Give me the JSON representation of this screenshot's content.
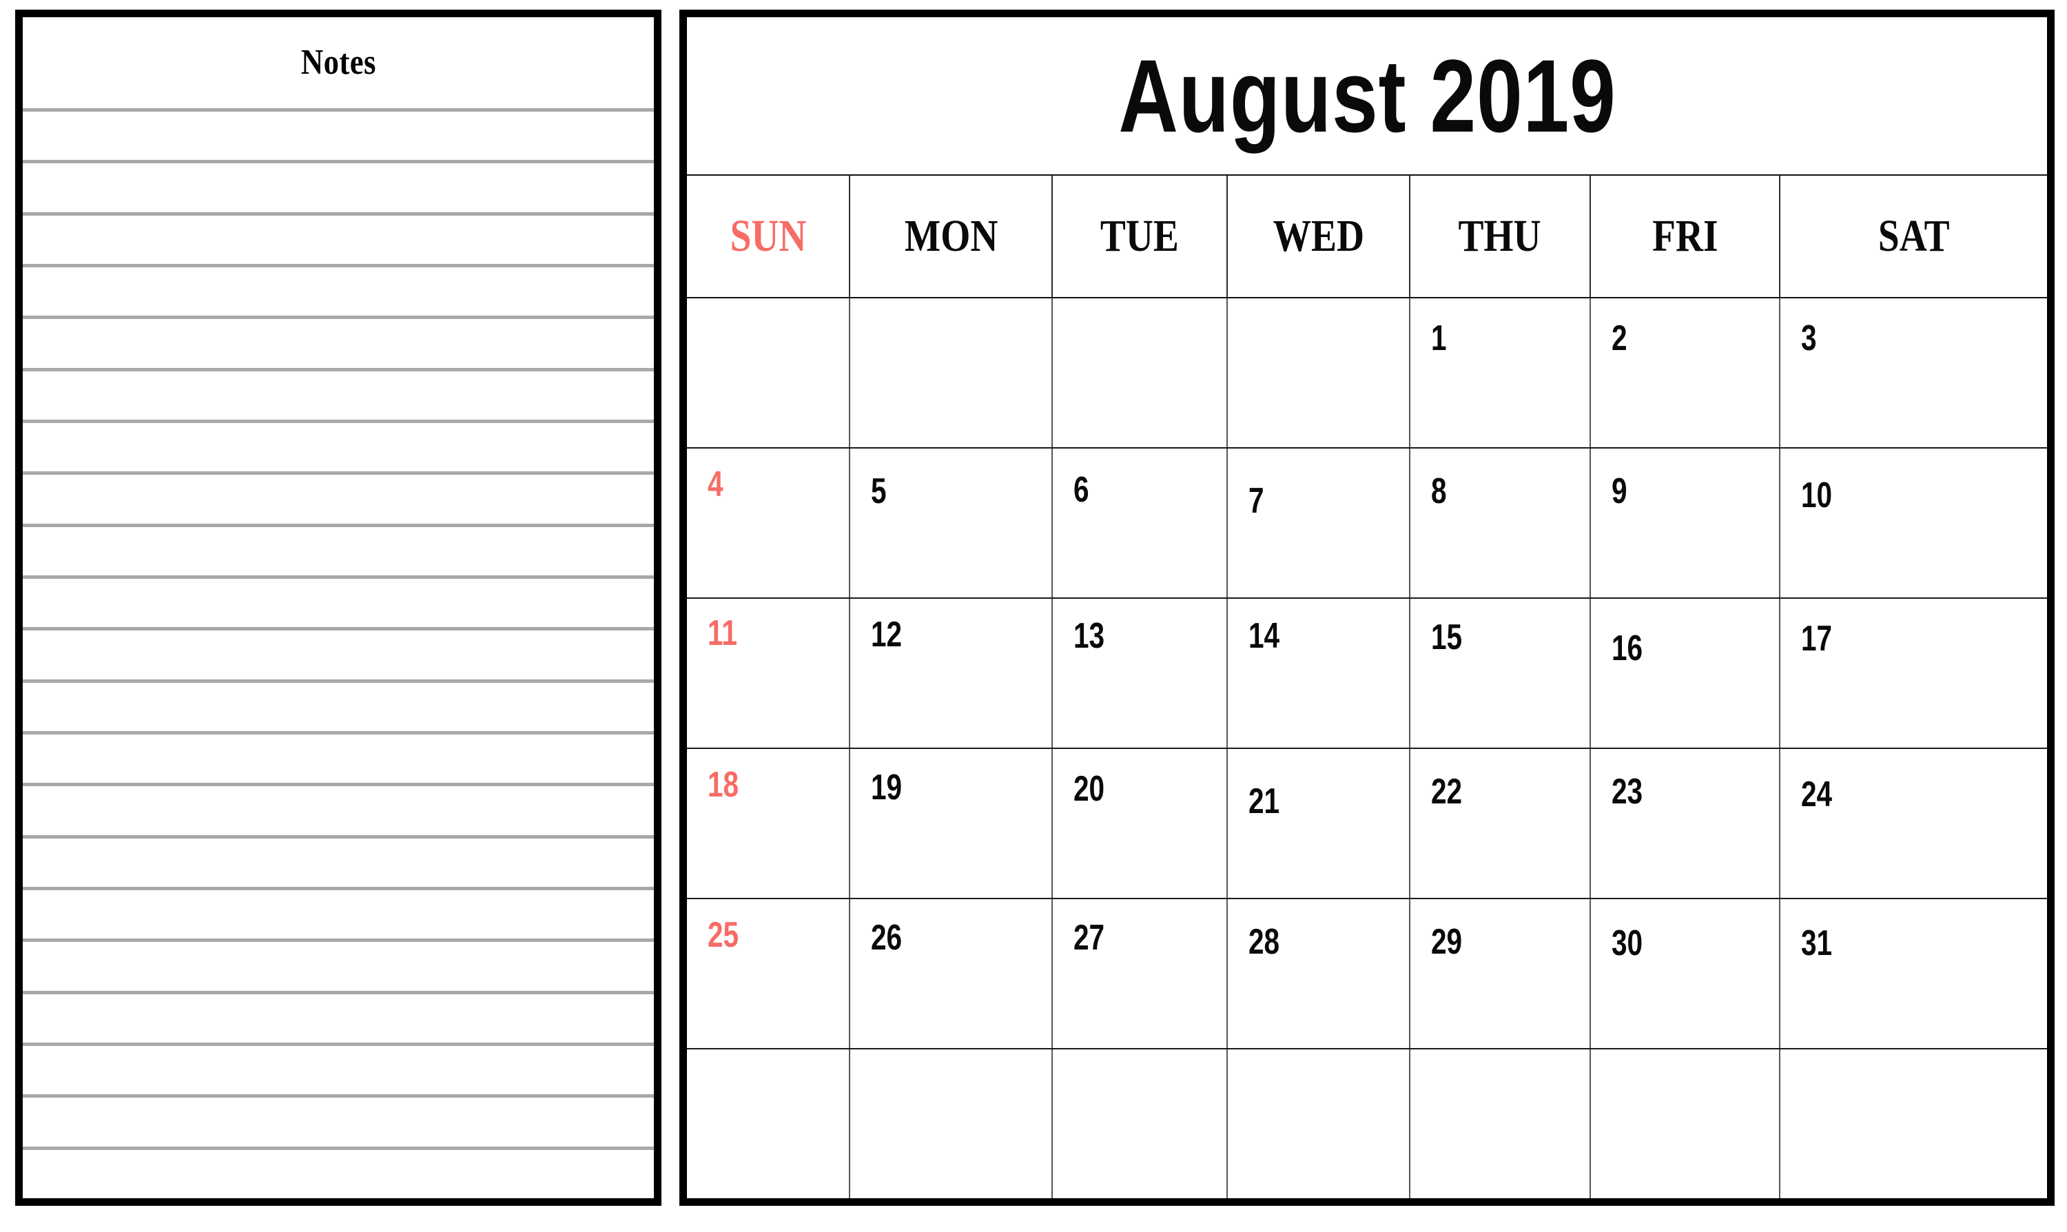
{
  "notes": {
    "title": "Notes",
    "line_count": 21
  },
  "calendar": {
    "title": "August 2019",
    "month": "August",
    "year": "2019",
    "weekday_headers": [
      {
        "label": "SUN",
        "is_sunday": true
      },
      {
        "label": "MON",
        "is_sunday": false
      },
      {
        "label": "TUE",
        "is_sunday": false
      },
      {
        "label": "WED",
        "is_sunday": false
      },
      {
        "label": "THU",
        "is_sunday": false
      },
      {
        "label": "FRI",
        "is_sunday": false
      },
      {
        "label": "SAT",
        "is_sunday": false
      }
    ],
    "weeks": [
      {
        "days": [
          {
            "label": "",
            "offset": 0
          },
          {
            "label": "",
            "offset": 0
          },
          {
            "label": "",
            "offset": 0
          },
          {
            "label": "",
            "offset": 0
          },
          {
            "label": "1",
            "offset": 18
          },
          {
            "label": "2",
            "offset": 18
          },
          {
            "label": "3",
            "offset": 18
          }
        ]
      },
      {
        "days": [
          {
            "label": "4",
            "offset": 12
          },
          {
            "label": "5",
            "offset": 22
          },
          {
            "label": "6",
            "offset": 20
          },
          {
            "label": "7",
            "offset": 36
          },
          {
            "label": "8",
            "offset": 22
          },
          {
            "label": "9",
            "offset": 22
          },
          {
            "label": "10",
            "offset": 28
          }
        ]
      },
      {
        "days": [
          {
            "label": "11",
            "offset": 10
          },
          {
            "label": "12",
            "offset": 12
          },
          {
            "label": "13",
            "offset": 14
          },
          {
            "label": "14",
            "offset": 14
          },
          {
            "label": "15",
            "offset": 16
          },
          {
            "label": "16",
            "offset": 32
          },
          {
            "label": "17",
            "offset": 18
          }
        ]
      },
      {
        "days": [
          {
            "label": "18",
            "offset": 12
          },
          {
            "label": "19",
            "offset": 16
          },
          {
            "label": "20",
            "offset": 18
          },
          {
            "label": "21",
            "offset": 36
          },
          {
            "label": "22",
            "offset": 22
          },
          {
            "label": "23",
            "offset": 22
          },
          {
            "label": "24",
            "offset": 26
          }
        ]
      },
      {
        "days": [
          {
            "label": "25",
            "offset": 12
          },
          {
            "label": "26",
            "offset": 16
          },
          {
            "label": "27",
            "offset": 16
          },
          {
            "label": "28",
            "offset": 22
          },
          {
            "label": "29",
            "offset": 22
          },
          {
            "label": "30",
            "offset": 24
          },
          {
            "label": "31",
            "offset": 24
          }
        ]
      },
      {
        "days": [
          {
            "label": "",
            "offset": 0
          },
          {
            "label": "",
            "offset": 0
          },
          {
            "label": "",
            "offset": 0
          },
          {
            "label": "",
            "offset": 0
          },
          {
            "label": "",
            "offset": 0
          },
          {
            "label": "",
            "offset": 0
          },
          {
            "label": "",
            "offset": 0
          }
        ]
      }
    ]
  },
  "colors": {
    "sunday_accent": "#f76c65",
    "ink": "#0a0a0a",
    "rule": "#a8a8a8",
    "border": "#000000",
    "page_background": "#ffffff"
  }
}
